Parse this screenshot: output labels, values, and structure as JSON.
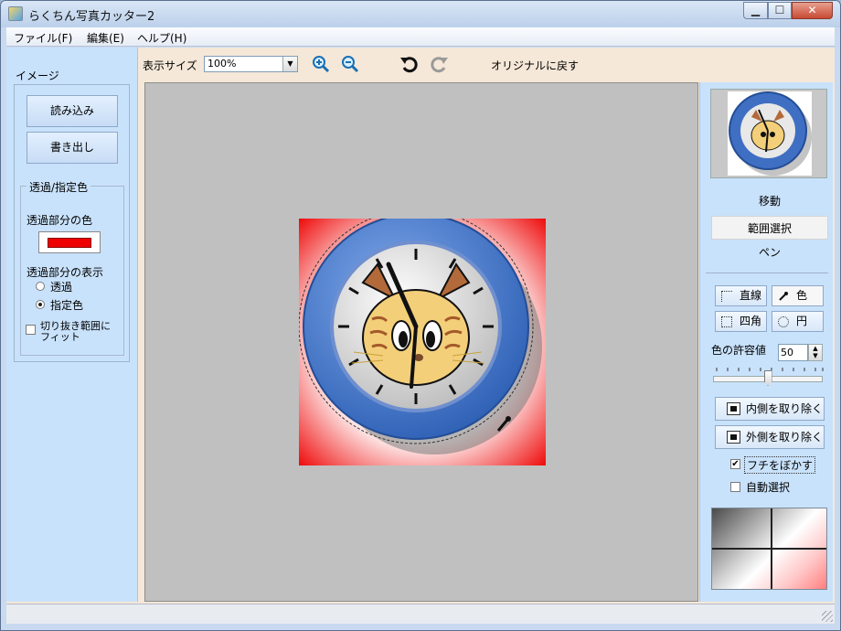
{
  "window": {
    "title": "らくちん写真カッター2",
    "controls": {
      "minimize": "▁",
      "maximize": "☐",
      "close": "✕"
    }
  },
  "menu": [
    "ファイル(F)",
    "編集(E)",
    "ヘルプ(H)"
  ],
  "left_panel": {
    "title": "イメージ",
    "load_button": "読み込み",
    "export_button": "書き出し",
    "group_title": "透過/指定色",
    "transparent_color_label": "透過部分の色",
    "transparent_color": "#ee0000",
    "display_label": "透過部分の表示",
    "radio_transparent": "透過",
    "radio_specified": "指定色",
    "selected_display": "指定色",
    "fit_checkbox": {
      "label_line1": "切り抜き範囲に",
      "label_line2": "フィット",
      "checked": false
    }
  },
  "toolbar": {
    "zoom_label": "表示サイズ",
    "zoom_value": "100%",
    "zoom_in_icon": "zoom-in-icon",
    "zoom_out_icon": "zoom-out-icon",
    "undo_icon": "undo-icon",
    "redo_icon": "redo-icon",
    "revert_button": "オリジナルに戻す"
  },
  "right_panel": {
    "modes": [
      "移動",
      "範囲選択",
      "ペン"
    ],
    "selected_mode": "範囲選択",
    "shape_buttons": {
      "line": "直線",
      "color": "色",
      "rect": "四角",
      "circle": "円"
    },
    "selected_shape": "色",
    "tolerance_label": "色の許容値",
    "tolerance_value": "50",
    "tolerance_slider_fraction": 0.5,
    "remove_inside": "内側を取り除く",
    "remove_outside": "外側を取り除く",
    "blur_edges": {
      "label": "フチをぼかす",
      "checked": true
    },
    "auto_select": {
      "label": "自動選択",
      "checked": false
    }
  },
  "colors": {
    "accent_blue": "#3f6fc2",
    "background_red": "#ee0000",
    "canvas_gray": "#c0c0c0"
  }
}
